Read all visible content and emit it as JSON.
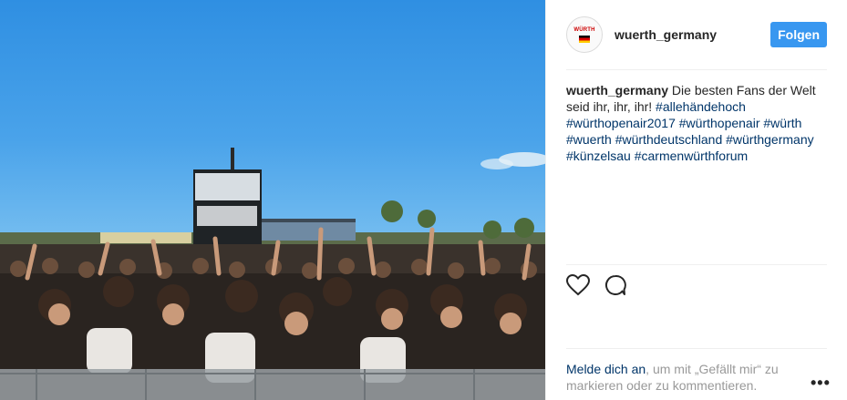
{
  "post": {
    "username": "wuerth_germany",
    "follow_label": "Folgen",
    "avatar_logo_text": "WÜRTH",
    "caption": {
      "user": "wuerth_germany",
      "text": " Die besten Fans der Welt seid ihr, ihr, ihr! ",
      "hashtags": [
        "#allehändehoch",
        "#würthopenair2017",
        "#würthopenair",
        "#würth",
        "#wuerth",
        "#würthdeutschland",
        "#würthgermany",
        "#künzelsau",
        "#carmenwürthforum"
      ]
    },
    "login_prompt": {
      "link": "Melde dich an",
      "text": ", um mit „Gefällt mir“ zu markieren oder zu kommentieren."
    },
    "more_label": "•••"
  },
  "colors": {
    "follow_button": "#3897f0",
    "hashtag": "#003569",
    "muted_text": "#999999"
  }
}
